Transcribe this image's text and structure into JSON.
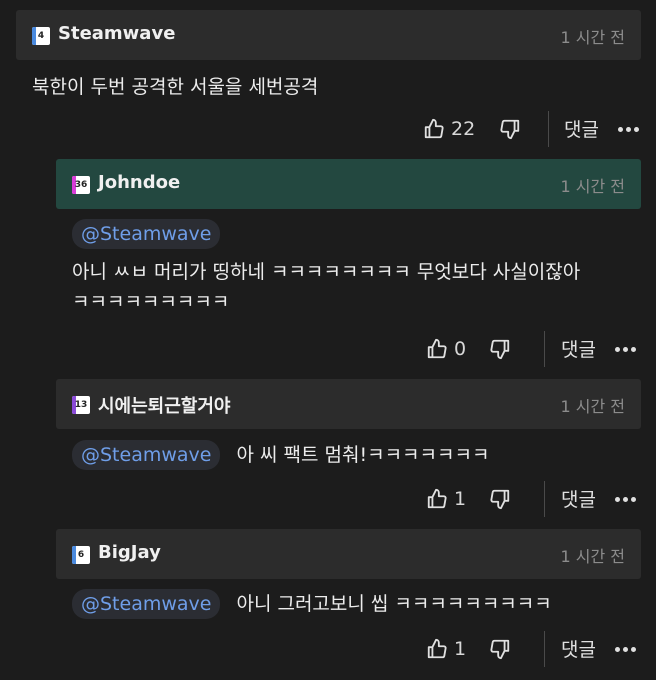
{
  "comments": [
    {
      "username": "Steamwave",
      "level": "4",
      "level_color": "#4a8adf",
      "time": "1 시간 전",
      "mention": "",
      "text_lines": [
        "북한이 두번 공격한 서울을 세번공격"
      ],
      "likes": "22",
      "reply_label": "댓글"
    },
    {
      "username": "Johndoe",
      "level": "36",
      "level_color": "#d83bd8",
      "time": "1 시간 전",
      "mention": "@Steamwave",
      "text_lines": [
        "아니 ㅆㅂ 머리가 띵하네 ㅋㅋㅋㅋㅋㅋㅋㅋ 무엇보다 사실이잖아",
        "ㅋㅋㅋㅋㅋㅋㅋㅋㅋ"
      ],
      "likes": "0",
      "reply_label": "댓글"
    },
    {
      "username": "시에는퇴근할거야",
      "level": "13",
      "level_color": "#8a4ad8",
      "time": "1 시간 전",
      "mention": "@Steamwave",
      "text_lines": [
        "아 씨 팩트 멈춰!ㅋㅋㅋㅋㅋㅋㅋ"
      ],
      "likes": "1",
      "reply_label": "댓글"
    },
    {
      "username": "BigJay",
      "level": "6",
      "level_color": "#4a8adf",
      "time": "1 시간 전",
      "mention": "@Steamwave",
      "text_lines": [
        "아니 그러고보니 씹 ㅋㅋㅋㅋㅋㅋㅋㅋㅋ"
      ],
      "likes": "1",
      "reply_label": "댓글"
    }
  ],
  "icons": {
    "like": "thumbs-up-icon",
    "dislike": "thumbs-down-icon",
    "more": "more-dots-icon"
  }
}
